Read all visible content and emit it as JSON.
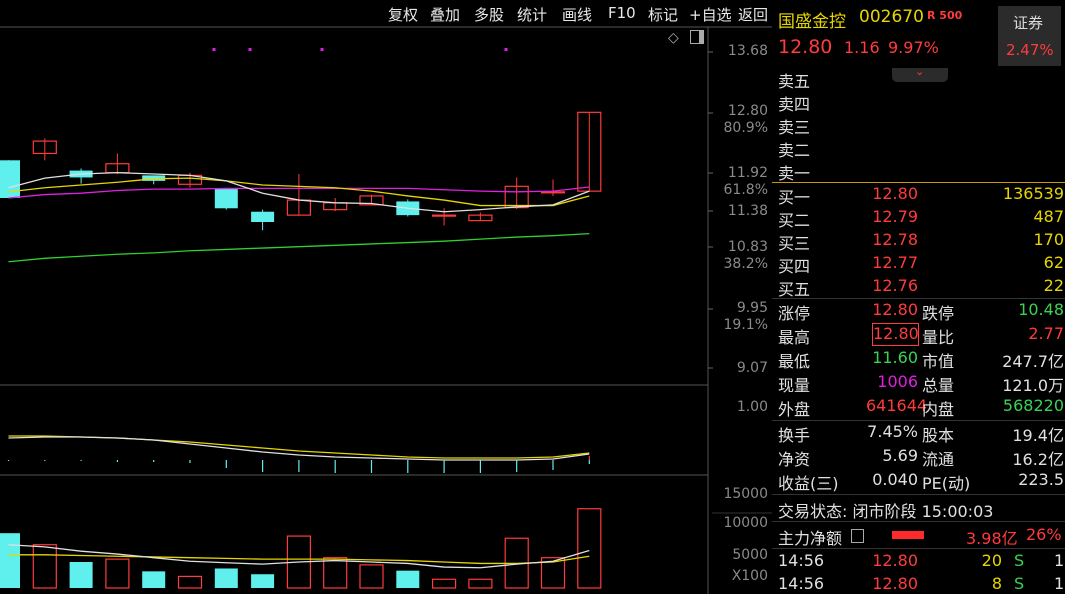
{
  "toolbar": {
    "items": [
      "复权",
      "叠加",
      "多股",
      "统计",
      "画线",
      "F10",
      "标记",
      "+自选",
      "返回"
    ]
  },
  "price_axis": [
    "13.68",
    "12.80",
    "80.9%",
    "11.92",
    "61.8%",
    "11.38",
    "10.83",
    "38.2%",
    "9.95",
    "19.1%",
    "9.07"
  ],
  "macd_axis": [
    "1.00"
  ],
  "vol_axis": [
    "15000",
    "10000",
    "5000",
    "X100"
  ],
  "colors": {
    "up": "#ff3b3b",
    "down": "#39d353",
    "cyan": "#5ff0ee",
    "yellow": "#e6d600",
    "magenta": "#e020e0",
    "white": "#e0e0e0",
    "green": "#2fd02f"
  },
  "stock": {
    "name": "国盛金控",
    "code": "002670",
    "badge": "R 500",
    "price": "12.80",
    "change": "1.16",
    "pct": "9.97%",
    "sector_label": "证券",
    "sector_pct": "2.47%"
  },
  "sell": [
    {
      "label": "卖五"
    },
    {
      "label": "卖四"
    },
    {
      "label": "卖三"
    },
    {
      "label": "卖二"
    },
    {
      "label": "卖一"
    }
  ],
  "buy": [
    {
      "label": "买一",
      "price": "12.80",
      "vol": "136539"
    },
    {
      "label": "买二",
      "price": "12.79",
      "vol": "487"
    },
    {
      "label": "买三",
      "price": "12.78",
      "vol": "170"
    },
    {
      "label": "买四",
      "price": "12.77",
      "vol": "62"
    },
    {
      "label": "买五",
      "price": "12.76",
      "vol": "22"
    }
  ],
  "stats": [
    {
      "k1": "涨停",
      "v1": "12.80",
      "c1": "up",
      "k2": "跌停",
      "v2": "10.48",
      "c2": "dn"
    },
    {
      "k1": "最高",
      "v1": "12.80",
      "c1": "up",
      "k2": "量比",
      "v2": "2.77",
      "c2": "up"
    },
    {
      "k1": "最低",
      "v1": "11.60",
      "c1": "dn",
      "k2": "市值",
      "v2": "247.7亿",
      "c2": "wht"
    },
    {
      "k1": "现量",
      "v1": "1006",
      "c1": "mag",
      "k2": "总量",
      "v2": "121.0万",
      "c2": "wht"
    },
    {
      "k1": "外盘",
      "v1": "641644",
      "c1": "up",
      "k2": "内盘",
      "v2": "568220",
      "c2": "dn"
    }
  ],
  "fin": [
    {
      "k1": "换手",
      "v1": "7.45%",
      "k2": "股本",
      "v2": "19.4亿"
    },
    {
      "k1": "净资",
      "v1": "5.69",
      "k2": "流通",
      "v2": "16.2亿"
    },
    {
      "k1": "收益(三)",
      "v1": "0.040",
      "k2": "PE(动)",
      "v2": "223.5"
    }
  ],
  "trade_status": "交易状态: 闭市阶段 15:00:03",
  "main_flow": {
    "label": "主力净额",
    "value": "3.98亿",
    "pct": "26%"
  },
  "ticks": [
    {
      "time": "14:56",
      "price": "12.80",
      "vol": "20",
      "side": "S",
      "count": "1"
    },
    {
      "time": "14:56",
      "price": "12.80",
      "vol": "8",
      "side": "S",
      "count": "1"
    }
  ],
  "chart_data": {
    "type": "candlestick",
    "candles": [
      {
        "o": 12.1,
        "c": 11.55,
        "h": 12.1,
        "l": 11.55
      },
      {
        "o": 12.2,
        "c": 12.38,
        "h": 12.42,
        "l": 12.1
      },
      {
        "o": 11.95,
        "c": 11.85,
        "h": 11.98,
        "l": 11.76
      },
      {
        "o": 11.92,
        "c": 12.05,
        "h": 12.2,
        "l": 11.9
      },
      {
        "o": 11.88,
        "c": 11.8,
        "h": 11.88,
        "l": 11.75
      },
      {
        "o": 11.75,
        "c": 11.88,
        "h": 11.92,
        "l": 11.7
      },
      {
        "o": 11.68,
        "c": 11.4,
        "h": 11.68,
        "l": 11.38
      },
      {
        "o": 11.35,
        "c": 11.2,
        "h": 11.38,
        "l": 11.08
      },
      {
        "o": 11.3,
        "c": 11.52,
        "h": 11.9,
        "l": 11.3
      },
      {
        "o": 11.38,
        "c": 11.48,
        "h": 11.55,
        "l": 11.36
      },
      {
        "o": 11.45,
        "c": 11.58,
        "h": 11.6,
        "l": 11.44
      },
      {
        "o": 11.5,
        "c": 11.3,
        "h": 11.53,
        "l": 11.28
      },
      {
        "o": 11.3,
        "c": 11.3,
        "h": 11.4,
        "l": 11.15
      },
      {
        "o": 11.22,
        "c": 11.3,
        "h": 11.34,
        "l": 11.22
      },
      {
        "o": 11.41,
        "c": 11.72,
        "h": 11.85,
        "l": 11.39
      },
      {
        "o": 11.64,
        "c": 11.64,
        "h": 11.82,
        "l": 11.58
      },
      {
        "o": 11.65,
        "c": 12.8,
        "h": 12.8,
        "l": 11.64
      }
    ],
    "ma_white": [
      11.7,
      11.84,
      11.9,
      11.92,
      11.9,
      11.88,
      11.8,
      11.62,
      11.52,
      11.48,
      11.47,
      11.4,
      11.35,
      11.38,
      11.42,
      11.45,
      11.65
    ],
    "ma_yellow": [
      11.64,
      11.7,
      11.74,
      11.78,
      11.83,
      11.84,
      11.8,
      11.74,
      11.72,
      11.7,
      11.65,
      11.58,
      11.52,
      11.44,
      11.44,
      11.44,
      11.58
    ],
    "ma_magenta": [
      11.55,
      11.6,
      11.62,
      11.66,
      11.68,
      11.68,
      11.69,
      11.69,
      11.69,
      11.69,
      11.69,
      11.69,
      11.67,
      11.65,
      11.64,
      11.65,
      11.71
    ],
    "ma_green": [
      10.62,
      10.67,
      10.7,
      10.73,
      10.75,
      10.78,
      10.8,
      10.82,
      10.84,
      10.86,
      10.88,
      10.9,
      10.92,
      10.95,
      10.98,
      11.0,
      11.03
    ],
    "volume": [
      9000,
      7400,
      5000,
      5400,
      3700,
      3000,
      4100,
      3300,
      8600,
      5600,
      4600,
      3800,
      2600,
      2600,
      8300,
      5600,
      12400
    ],
    "vol_ma": [
      7400,
      7100,
      6500,
      6100,
      5600,
      5100,
      4900,
      4700,
      5000,
      5200,
      5000,
      4800,
      4300,
      4200,
      4700,
      5100,
      6600
    ],
    "vol_ma2": [
      6000,
      6000,
      5900,
      5800,
      5700,
      5600,
      5500,
      5400,
      5400,
      5400,
      5300,
      5200,
      5000,
      4800,
      4800,
      5000,
      5800
    ],
    "ylim": [
      9.07,
      13.68
    ],
    "vol_ylim": [
      0,
      15000
    ]
  }
}
